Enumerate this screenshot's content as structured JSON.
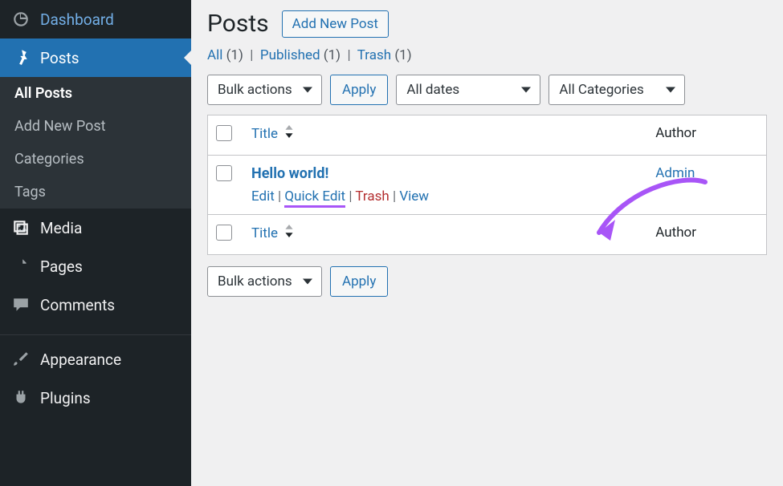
{
  "sidebar": {
    "dashboard": "Dashboard",
    "posts": "Posts",
    "submenu": {
      "all_posts": "All Posts",
      "add_new": "Add New Post",
      "categories": "Categories",
      "tags": "Tags"
    },
    "media": "Media",
    "pages": "Pages",
    "comments": "Comments",
    "appearance": "Appearance",
    "plugins": "Plugins"
  },
  "page": {
    "title": "Posts",
    "add_new": "Add New Post"
  },
  "statuses": {
    "all_label": "All",
    "all_count": "(1)",
    "published_label": "Published",
    "published_count": "(1)",
    "trash_label": "Trash",
    "trash_count": "(1)"
  },
  "controls": {
    "bulk_actions": "Bulk actions",
    "apply": "Apply",
    "all_dates": "All dates",
    "all_categories": "All Categories"
  },
  "table": {
    "title_header": "Title",
    "author_header": "Author",
    "row": {
      "title": "Hello world!",
      "author": "Admin",
      "actions": {
        "edit": "Edit",
        "quick_edit": "Quick Edit",
        "trash": "Trash",
        "view": "View"
      }
    }
  },
  "annotation": {
    "arrow_color": "#a855f7"
  }
}
